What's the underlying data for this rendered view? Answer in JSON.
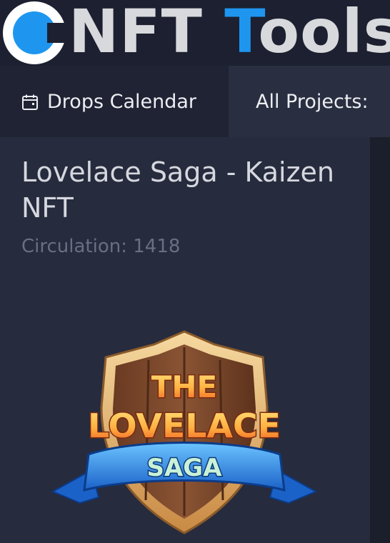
{
  "header": {
    "brand_part1": "NFT ",
    "brand_part2": "T",
    "brand_part3": "ools",
    "brand_color": "#1e96f0"
  },
  "nav": {
    "drops_label": "Drops Calendar",
    "drops_icon": "calendar-icon",
    "projects_label": "All Projects:"
  },
  "project": {
    "title": "Lovelace Saga - Kaizen NFT",
    "circulation_label": "Circulation:",
    "circulation_value": "1418",
    "logo_text_line1": "THE",
    "logo_text_line2": "LOVELACE",
    "logo_text_line3": "SAGA"
  }
}
